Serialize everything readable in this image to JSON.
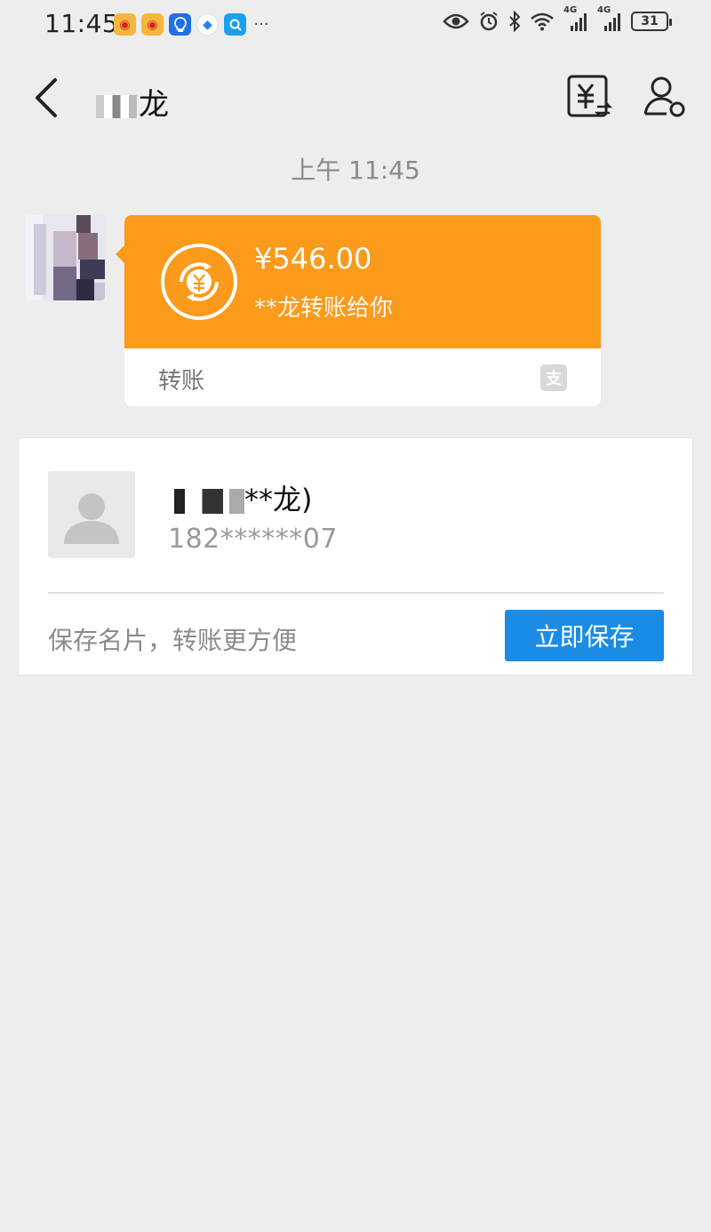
{
  "status_bar": {
    "time": "11:45",
    "notification_icons": [
      "weibo-icon",
      "weibo-icon",
      "lightbulb-icon",
      "vpn-icon",
      "search-icon",
      "more-icon"
    ],
    "more_text": "···",
    "signal_label_1": "4G",
    "signal_label_2": "4G",
    "battery_level": "31"
  },
  "header": {
    "title_visible_char": "龙"
  },
  "chat": {
    "timestamp": "上午 11:45",
    "transfer_message": {
      "amount": "¥546.00",
      "description": "**龙转账给你",
      "footer_label": "转账",
      "accent_color": "#fb9a1b"
    }
  },
  "contact_card": {
    "name_suffix": "**龙)",
    "phone": "182******07",
    "save_hint": "保存名片，转账更方便",
    "save_button_label": "立即保存",
    "button_color": "#1b8ce5"
  }
}
